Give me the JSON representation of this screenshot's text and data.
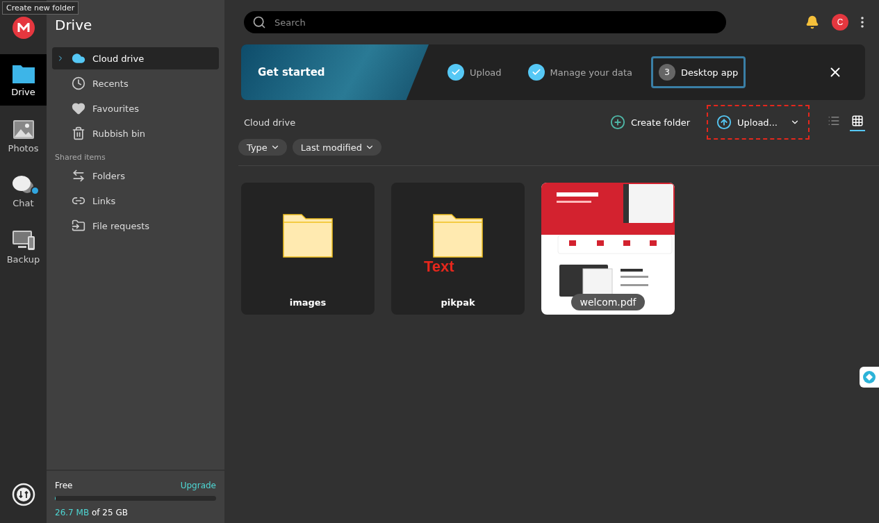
{
  "tooltip": "Create new folder",
  "rail": [
    {
      "label": "Drive",
      "selected": true,
      "badge": false
    },
    {
      "label": "Photos",
      "selected": false,
      "badge": false
    },
    {
      "label": "Chat",
      "selected": false,
      "badge": true
    },
    {
      "label": "Backup",
      "selected": false,
      "badge": false
    }
  ],
  "sidebar": {
    "title": "Drive",
    "items": [
      {
        "label": "Cloud drive",
        "selected": true,
        "expandable": true
      },
      {
        "label": "Recents",
        "selected": false,
        "expandable": false
      },
      {
        "label": "Favourites",
        "selected": false,
        "expandable": false
      },
      {
        "label": "Rubbish bin",
        "selected": false,
        "expandable": false
      }
    ],
    "section": "Shared items",
    "shared": [
      {
        "label": "Folders",
        "selected": false
      },
      {
        "label": "Links",
        "selected": false
      },
      {
        "label": "File requests",
        "selected": false
      }
    ],
    "storage": {
      "plan": "Free",
      "upgrade": "Upgrade",
      "used": "26.7 MB",
      "total": "of 25 GB",
      "level": 0.001
    }
  },
  "search": {
    "placeholder": "Search"
  },
  "avatar": "C",
  "banner": {
    "title": "Get started",
    "steps": [
      {
        "label": "Upload",
        "done": true,
        "selected": false
      },
      {
        "label": "Manage your data",
        "done": true,
        "selected": false
      },
      {
        "label": "Desktop app",
        "number": "3",
        "done": false,
        "selected": true
      }
    ]
  },
  "breadcrumb": "Cloud drive",
  "actions": {
    "create": "Create folder",
    "upload": "Upload..."
  },
  "view": {
    "list": false,
    "grid": true
  },
  "filters": [
    "Type",
    "Last modified"
  ],
  "files": [
    {
      "name": "images",
      "kind": "folder"
    },
    {
      "name": "pikpak",
      "kind": "folder",
      "annotation": "Text"
    },
    {
      "name": "welcom.pdf",
      "kind": "pdf"
    }
  ]
}
